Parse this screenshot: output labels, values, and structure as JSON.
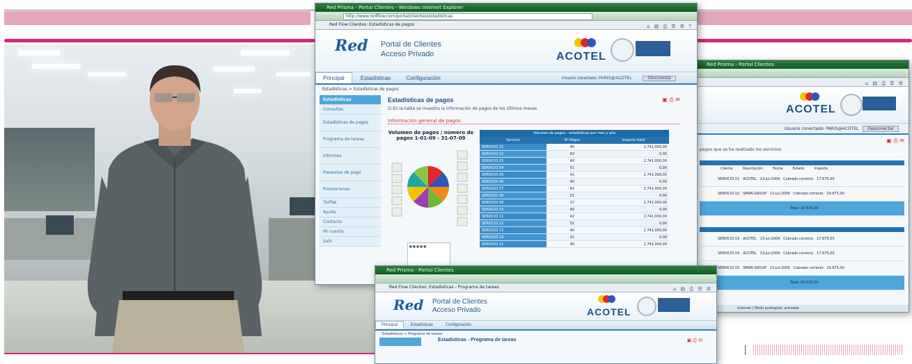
{
  "decor": {
    "accent_color": "#d6247a",
    "band_color": "#e3a6bd"
  },
  "main_window": {
    "titlebar": "Red Prisma - Portal Clientes - Windows Internet Explorer",
    "address": "http://www.redflow.com/portal/clientes/estadisticas",
    "tab": "Red Flow Clientes: Estadísticas de pagos",
    "logo": "Red",
    "portal_title_line1": "Portal de Clientes",
    "portal_title_line2": "Acceso Privado",
    "brand": "ACOTEL",
    "nav_tabs": [
      "Principal",
      "Estadísticas",
      "Configuración"
    ],
    "user_info": "Usuario conectado: PARIS@ACOTEL",
    "logout": "Desconectar",
    "breadcrumb": "Estadísticas > Estadísticas de pagos",
    "sidebar": [
      "Estadísticas",
      "Consultas",
      "Estadísticas de pagos",
      "Programa de tareas",
      "Informes",
      "Pasarelas de pago",
      "Promociones",
      "Tarifas",
      "Ayuda",
      "Contacto",
      "Mi cuenta",
      "Salir"
    ],
    "content_title": "Estadísticas de pagos",
    "content_note": "En la tabla se muestra la información de pagos de los últimos meses",
    "content_subtitle": "Información general de pagos",
    "chart_title_line1": "Volumen de pagos / número de",
    "chart_title_line2": "pagos 1-01-09 - 31-07-09",
    "table_caption": "Volumen de pagos - estadísticas por mes y año",
    "table_headers": [
      "Servicio",
      "Nº Pagos",
      "Importe total"
    ],
    "table_rows": [
      {
        "name": "SERVICIO 01",
        "num": "40",
        "amt": "2.741.000,00"
      },
      {
        "name": "SERVICIO 02",
        "num": "42",
        "amt": "0,00"
      },
      {
        "name": "SERVICIO 03",
        "num": "40",
        "amt": "2.741.000,00"
      },
      {
        "name": "SERVICIO 04",
        "num": "51",
        "amt": "0,00"
      },
      {
        "name": "SERVICIO 05",
        "num": "42",
        "amt": "2.741.000,00"
      },
      {
        "name": "SERVICIO 06",
        "num": "40",
        "amt": "0,00"
      },
      {
        "name": "SERVICIO 07",
        "num": "42",
        "amt": "2.741.000,00"
      },
      {
        "name": "SERVICIO 08",
        "num": "51",
        "amt": "0,00"
      },
      {
        "name": "SERVICIO 09",
        "num": "37",
        "amt": "2.741.000,00"
      },
      {
        "name": "SERVICIO 10",
        "num": "40",
        "amt": "0,00"
      },
      {
        "name": "SERVICIO 11",
        "num": "42",
        "amt": "2.741.000,00"
      },
      {
        "name": "SERVICIO 12",
        "num": "51",
        "amt": "0,00"
      },
      {
        "name": "SERVICIO 13",
        "num": "40",
        "amt": "2.741.000,00"
      },
      {
        "name": "SERVICIO 14",
        "num": "42",
        "amt": "0,00"
      },
      {
        "name": "SERVICIO 15",
        "num": "40",
        "amt": "2.741.000,00"
      }
    ]
  },
  "back_window": {
    "titlebar": "Red Prisma - Portal Clientes",
    "brand": "ACOTEL",
    "user_info": "Usuario conectado: PARIS@ACOTEL",
    "logout": "Desconectar",
    "note": "pagos que se ha realizado los servicios",
    "col_headers": [
      "Cliente",
      "Descripción",
      "Fecha",
      "Estado",
      "Importe"
    ],
    "rows": [
      [
        "SERVICIO 01",
        "ACOTEL",
        "13-jul-2009",
        "Cobrado correcto",
        "17.875,00"
      ],
      [
        "SERVICIO 02",
        "SPAIN GROUP",
        "13-jul-2009",
        "Cobrado correcto",
        "19.875,00"
      ],
      [
        "SERVICIO 03",
        "ACOTEL",
        "13-jul-2009",
        "Cobrado correcto",
        "17.875,00"
      ],
      [
        "SERVICIO 04",
        "ACOTEL",
        "13-jul-2009",
        "Cobrado correcto",
        "17.875,00"
      ],
      [
        "SERVICIO 05",
        "SPAIN GROUP",
        "13-jul-2009",
        "Cobrado correcto",
        "19.875,00"
      ]
    ],
    "totals": [
      "Total: 37.875,00",
      "Total: 55.625,00"
    ],
    "status": "Internet | Modo protegido: activado"
  },
  "bottom_window": {
    "titlebar": "Red Prisma - Portal Clientes",
    "tab": "Red Flow Clientes: Estadísticas - Programa de tareas",
    "logo": "Red",
    "portal_title_line1": "Portal de Clientes",
    "portal_title_line2": "Acceso Privado",
    "brand": "ACOTEL",
    "nav_tabs": [
      "Principal",
      "Estadísticas",
      "Configuración"
    ],
    "breadcrumb": "Estadísticas > Programa de tareas",
    "content_title": "Estadísticas - Programa de tareas"
  }
}
